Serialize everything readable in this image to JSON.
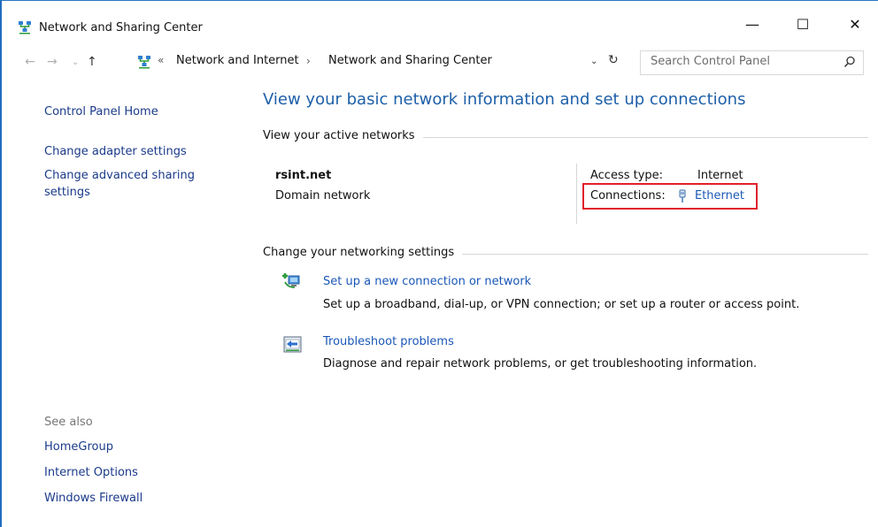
{
  "window": {
    "title": "Network and Sharing Center",
    "controls": {
      "minimize": "—",
      "maximize": "☐",
      "close": "✕"
    }
  },
  "navbar": {
    "back": "←",
    "forward": "→",
    "recent": "⌄",
    "up": "↑",
    "breadcrumb_overflow": "«",
    "breadcrumbs": [
      "Network and Internet",
      "Network and Sharing Center"
    ],
    "separator": "›",
    "dropdown": "⌄",
    "refresh": "↻",
    "search_placeholder": "Search Control Panel"
  },
  "sidebar": {
    "links": [
      "Control Panel Home",
      "Change adapter settings",
      "Change advanced sharing",
      "settings"
    ],
    "see_also_label": "See also",
    "see_also": [
      "HomeGroup",
      "Internet Options",
      "Windows Firewall"
    ]
  },
  "main": {
    "heading": "View your basic network information and set up connections",
    "active_section": "View your active networks",
    "network": {
      "name": "rsint.net",
      "type": "Domain network",
      "access_type_label": "Access type:",
      "access_type_value": "Internet",
      "connections_label": "Connections:",
      "connection_name": "Ethernet"
    },
    "change_section": "Change your networking settings",
    "tasks": [
      {
        "link": "Set up a new connection or network",
        "desc": "Set up a broadband, dial-up, or VPN connection; or set up a router or access point."
      },
      {
        "link": "Troubleshoot problems",
        "desc": "Diagnose and repair network problems, or get troubleshooting information."
      }
    ]
  },
  "colors": {
    "heading": "#1d5fa8",
    "link": "#1a57b8",
    "nav_link": "#1a3a8a",
    "highlight": "#e0212a"
  },
  "icons": {
    "title": "network-center-icon",
    "address": "network-center-icon",
    "search": "search-icon",
    "ethernet": "ethernet-icon",
    "setup": "new-connection-icon",
    "troubleshoot": "troubleshoot-icon"
  }
}
